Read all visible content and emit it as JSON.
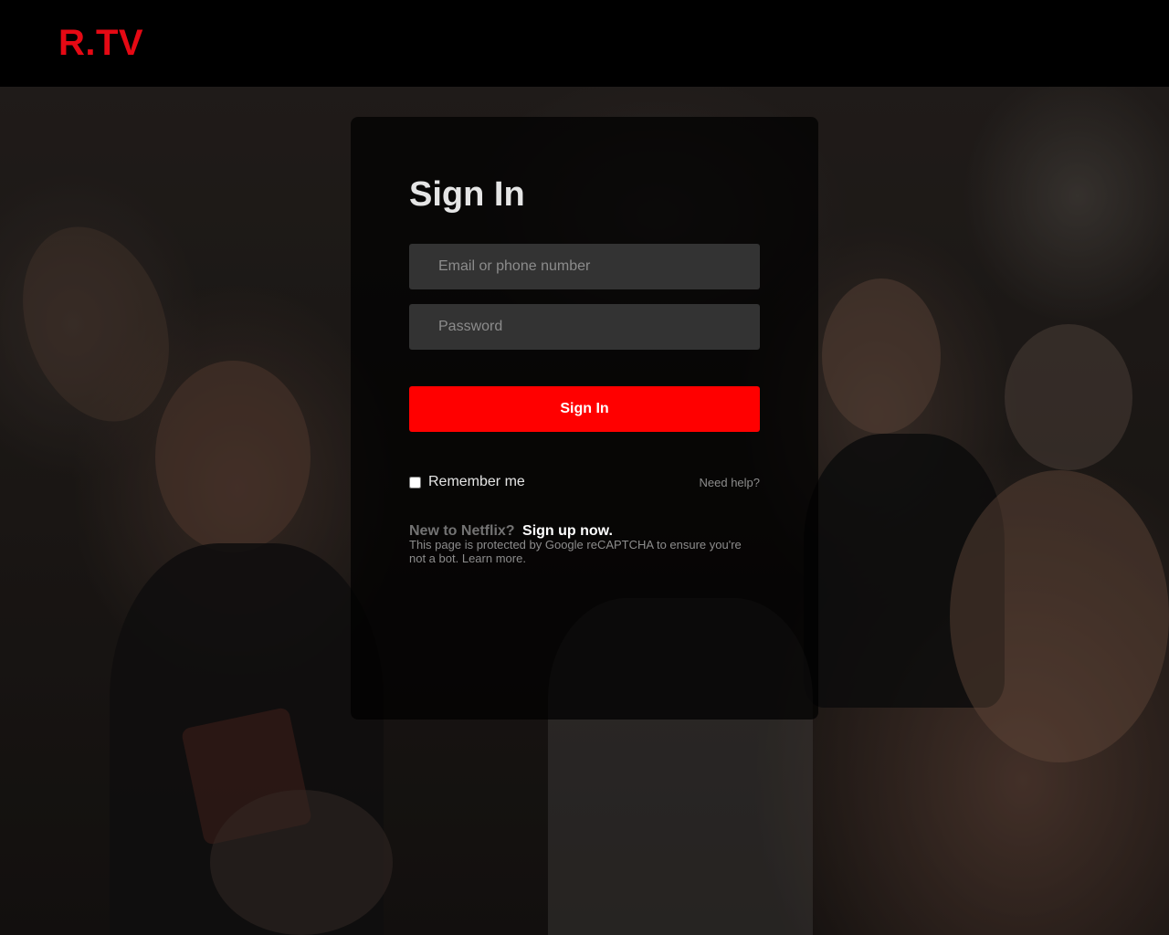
{
  "header": {
    "logo": "R.TV"
  },
  "signin": {
    "title": "Sign In",
    "email_placeholder": "Email or phone number",
    "password_placeholder": "Password",
    "submit_label": "Sign In",
    "remember_label": "Remember me",
    "remember_checked": false,
    "help_label": "Need help?",
    "new_to_label": "New to Netflix?",
    "signup_label": "Sign up now.",
    "recaptcha_text": "This page is protected by Google reCAPTCHA to ensure you're not a bot.",
    "learn_more_label": "Learn more."
  },
  "colors": {
    "brand": "#e50914",
    "button": "#ff0000",
    "field_bg": "#333333",
    "card_bg": "rgba(0,0,0,0.72)"
  }
}
